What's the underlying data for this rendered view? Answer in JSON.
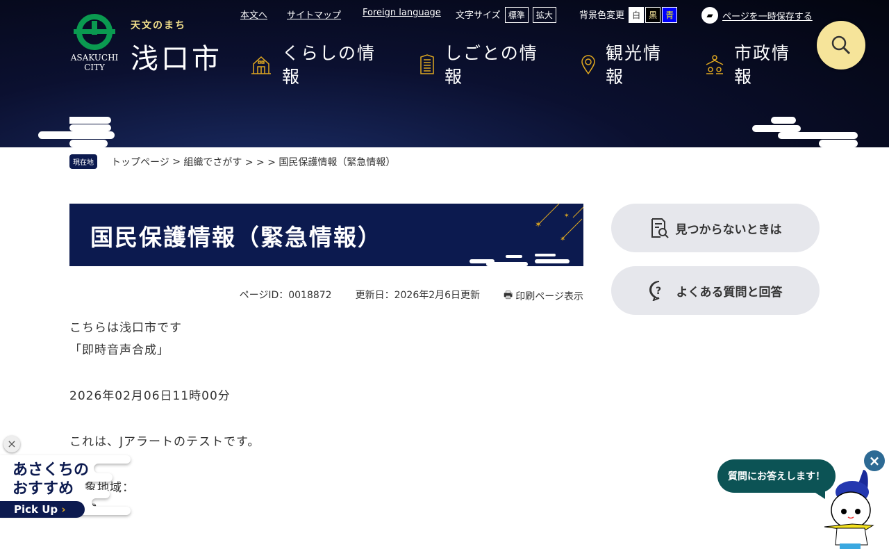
{
  "header": {
    "logo": {
      "tagline": "天文のまち",
      "name": "浅口市",
      "english": "ASAKUCHI CITY"
    },
    "utility": {
      "skip": "本文へ",
      "sitemap": "サイトマップ",
      "foreign": "Foreign language",
      "font_size_label": "文字サイズ",
      "font_standard": "標準",
      "font_large": "拡大",
      "bg_label": "背景色変更",
      "bg_white": "白",
      "bg_black": "黒",
      "bg_blue": "青",
      "save_page": "ページを一時保存する"
    },
    "nav": [
      {
        "label": "くらしの情報",
        "icon": "house-icon"
      },
      {
        "label": "しごとの情報",
        "icon": "building-icon"
      },
      {
        "label": "観光情報",
        "icon": "map-pin-icon"
      },
      {
        "label": "市政情報",
        "icon": "people-icon"
      }
    ],
    "search_icon": "search-icon"
  },
  "breadcrumb": {
    "here": "現在地",
    "items": [
      "トップページ",
      "組織でさがす"
    ],
    "sep": ">",
    "tail": "> > > 国民保護情報（緊急情報）"
  },
  "page": {
    "title": "国民保護情報（緊急情報）",
    "page_id": "ページID：0018872",
    "updated": "更新日：2026年2月6日更新",
    "print": "印刷ページ表示",
    "body": [
      "こちらは浅口市です",
      "「即時音声合成」",
      "2026年02月06日11時00分",
      "これは、Jアラートのテストです。",
      "対象地域：",
      "全域"
    ]
  },
  "sidebar": {
    "not_found": "見つからないときは",
    "faq": "よくある質問と回答"
  },
  "pickup": {
    "line1": "あさくちの",
    "line2": "おすすめ",
    "button": "Pick Up",
    "close": "×"
  },
  "chatbot": {
    "bubble": "質問にお答えします！",
    "close": "×"
  },
  "colors": {
    "navy": "#0c1a4f",
    "search": "#f6e49a",
    "icon_gold": "#e0a820",
    "chat": "#0c5355"
  }
}
